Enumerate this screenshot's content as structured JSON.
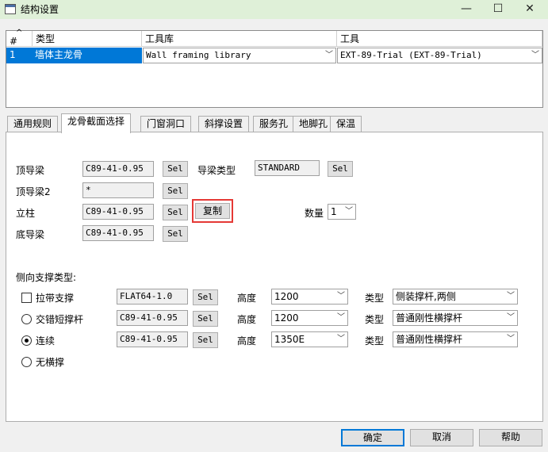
{
  "window": {
    "title": "结构设置",
    "controls": {
      "minimize": "—",
      "maximize": "☐",
      "close": "✕"
    }
  },
  "grid": {
    "headers": [
      "#",
      "类型",
      "工具库",
      "工具"
    ],
    "sort_indicator": "^",
    "rows": [
      {
        "num": "1",
        "type": "墙体主龙骨",
        "library": "Wall framing library",
        "tool": "EXT-89-Trial (EXT-89-Trial)"
      }
    ]
  },
  "tabs": [
    "通用规则",
    "龙骨截面选择",
    "门窗洞口",
    "斜撑设置",
    "服务孔",
    "地脚孔",
    "保温"
  ],
  "active_tab": 1,
  "section": {
    "top_track_label": "顶导梁",
    "top_track_value": "C89-41-0.95",
    "top_track2_label": "顶导梁2",
    "top_track2_value": "*",
    "stud_label": "立柱",
    "stud_value": "C89-41-0.95",
    "bottom_track_label": "底导梁",
    "bottom_track_value": "C89-41-0.95",
    "track_type_label": "导梁类型",
    "track_type_value": "STANDARD",
    "sel_label": "Sel",
    "copy_label": "复制",
    "quantity_label": "数量",
    "quantity_value": "1"
  },
  "bracing": {
    "title": "侧向支撑类型:",
    "height_label": "高度",
    "type_label": "类型",
    "rows": [
      {
        "label": "拉带支撑",
        "value": "FLAT64-1.0",
        "height": "1200",
        "type": "侧装撑杆,两侧",
        "control": "checkbox",
        "checked": false
      },
      {
        "label": "交错短撑杆",
        "value": "C89-41-0.95",
        "height": "1200",
        "type": "普通刚性横撑杆",
        "control": "radio",
        "checked": false
      },
      {
        "label": "连续",
        "value": "C89-41-0.95",
        "height": "1350E",
        "type": "普通刚性横撑杆",
        "control": "radio",
        "checked": true
      }
    ],
    "none_label": "无横撑"
  },
  "buttons": {
    "ok": "确定",
    "cancel": "取消",
    "help": "帮助"
  },
  "colors": {
    "titlebar": "#dff0d8",
    "selection": "#0078d7",
    "highlight_box": "#e53935"
  }
}
